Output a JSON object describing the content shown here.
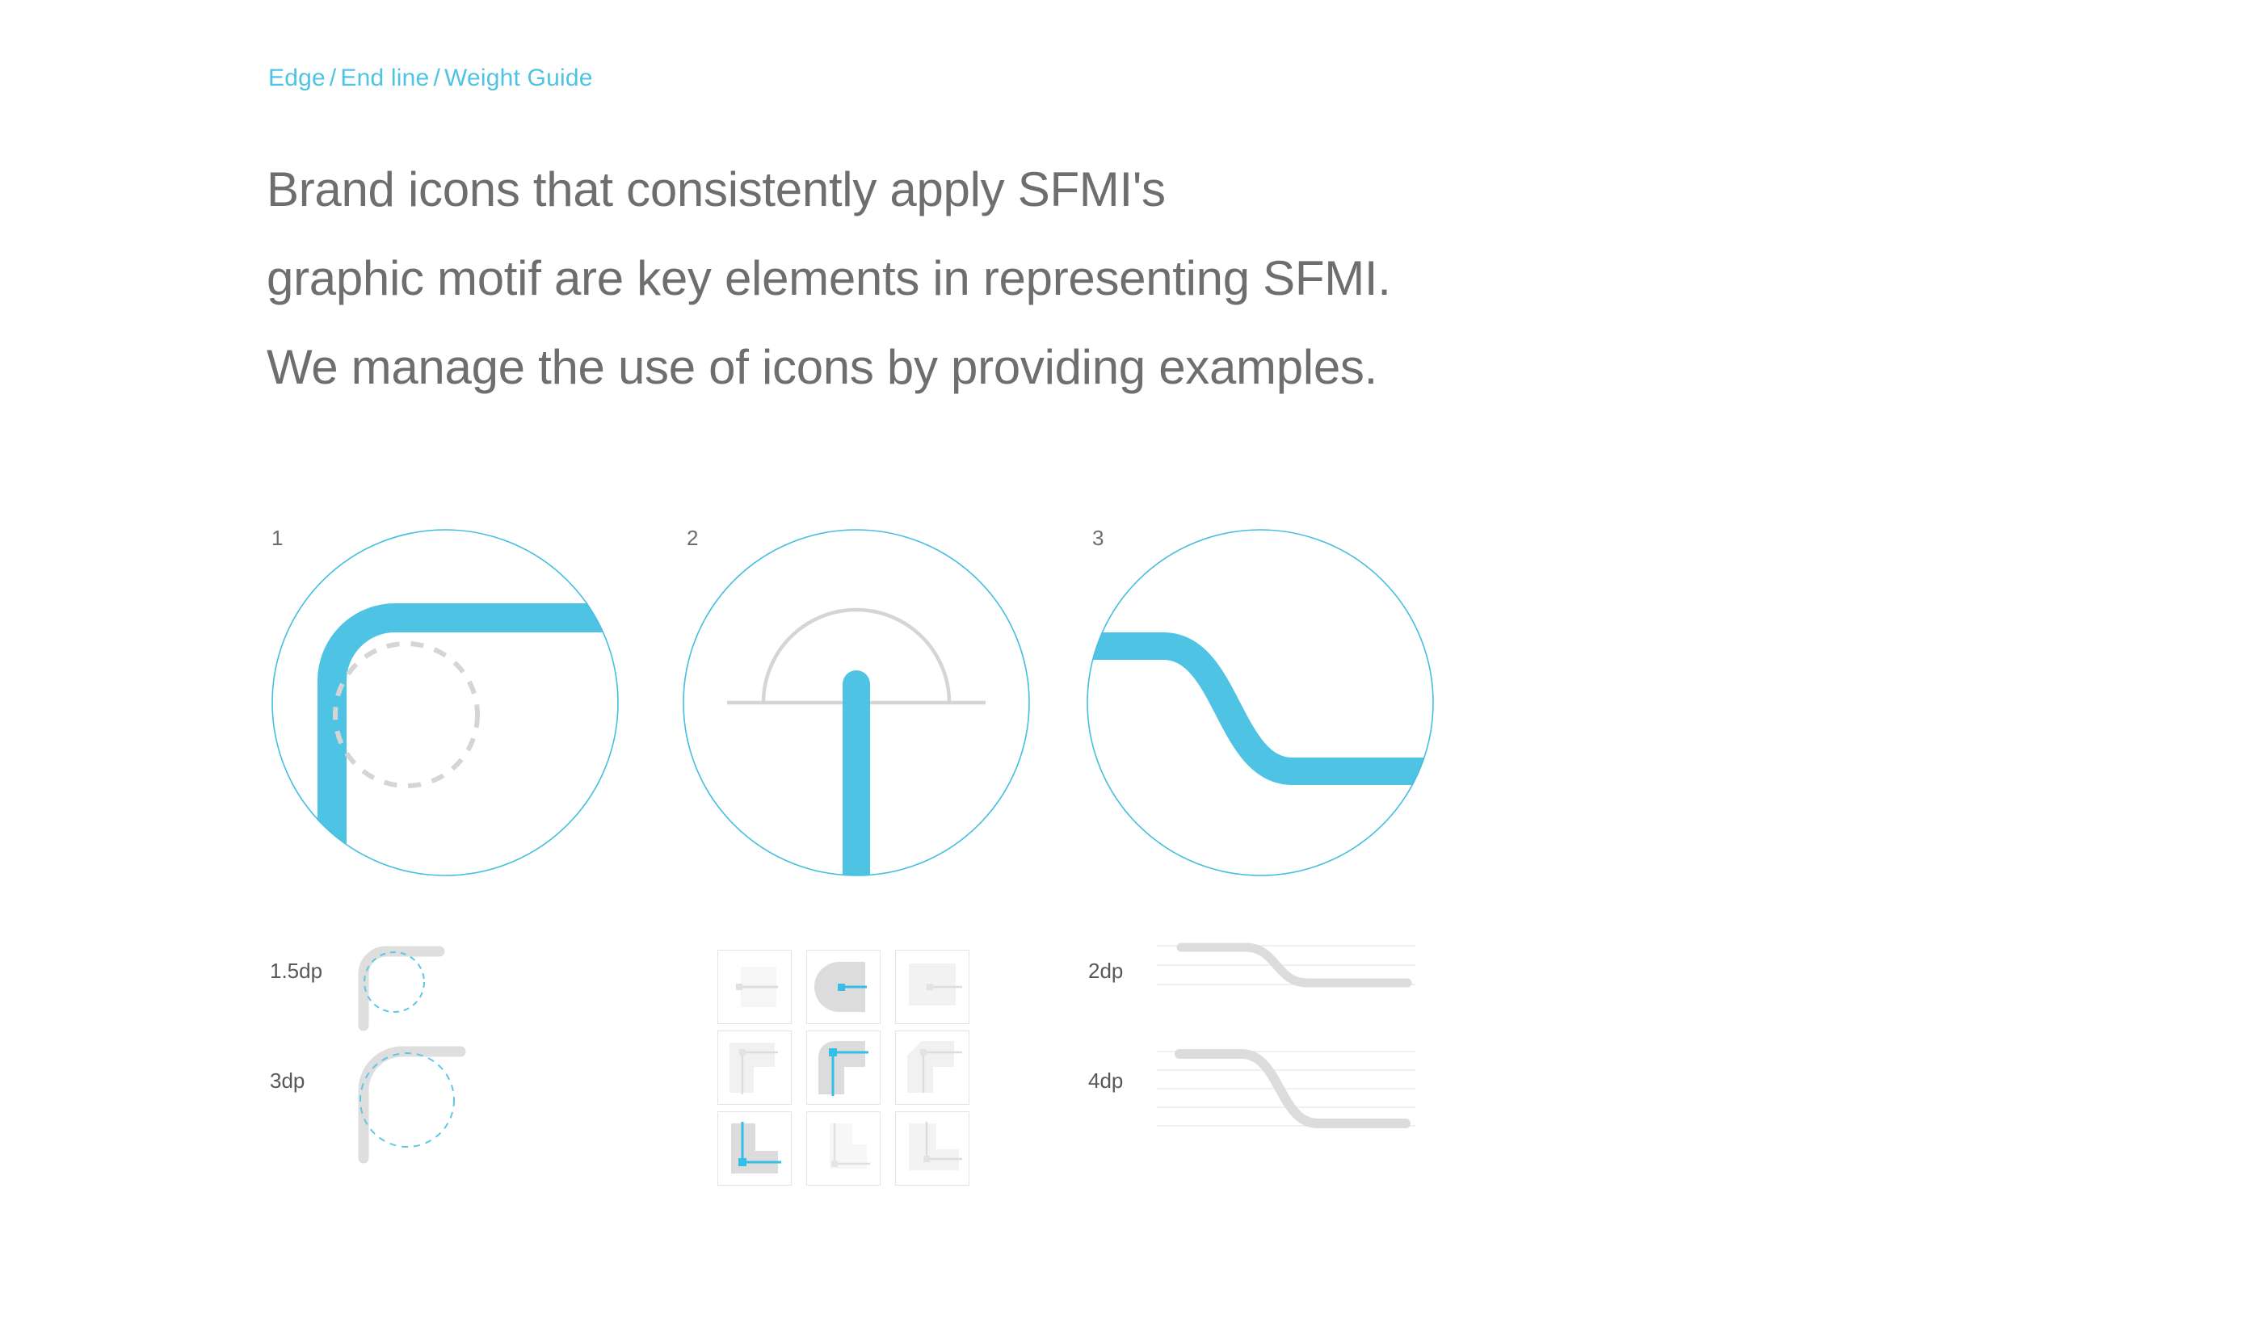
{
  "breadcrumb": {
    "items": [
      "Edge",
      "End line",
      "Weight Guide"
    ],
    "separator": "/",
    "color": "#4FC3E4",
    "item_0": "Edge",
    "item_1": "End line",
    "item_2": "Weight Guide"
  },
  "headline": {
    "line_1": "Brand icons that consistently apply SFMI's",
    "line_2": "graphic motif are key elements in representing SFMI.",
    "line_3": "We manage the use of icons by providing examples.",
    "color": "#6E6E6E"
  },
  "colors": {
    "accent_cyan": "#4FC3E4",
    "stroke_cyan": "#45BEE0",
    "text_grey": "#6E6E6E",
    "guide_grey": "#D8D8D8",
    "light_grey": "#EDEDED",
    "tile_border": "#E4E4E4",
    "background": "#FFFFFF"
  },
  "diagrams": [
    {
      "number": "1",
      "name": "rounded-corner-edge",
      "description": "Thick cyan rounded corner stroke with dashed grey construction circle inside a cyan outline circle"
    },
    {
      "number": "2",
      "name": "end-line-cap",
      "description": "Vertical cyan bar with rounded end cap, grey semicircular arc and horizontal baseline guide"
    },
    {
      "number": "3",
      "name": "s-curve-weight",
      "description": "Horizontal cyan S-curve band crossing the cyan outline circle"
    }
  ],
  "weight_samples": {
    "corner": [
      {
        "label": "1.5dp",
        "stroke_width": 1.5,
        "radius_small": true
      },
      {
        "label": "3dp",
        "stroke_width": 3,
        "radius_small": false
      }
    ],
    "curve": [
      {
        "label": "2dp",
        "stroke_width": 2,
        "guide_lines": 3
      },
      {
        "label": "4dp",
        "stroke_width": 4,
        "guide_lines": 5
      }
    ]
  },
  "tile_grid": {
    "rows": 3,
    "columns": 3,
    "tiles": [
      {
        "index": 1,
        "shape": "straight-edge",
        "highlighted": false,
        "name": "tile-straight-faint"
      },
      {
        "index": 2,
        "shape": "rounded-cap",
        "highlighted": true,
        "name": "tile-rounded-cap-active"
      },
      {
        "index": 3,
        "shape": "straight-edge",
        "highlighted": false,
        "name": "tile-straight-light"
      },
      {
        "index": 4,
        "shape": "corner-sharp",
        "highlighted": false,
        "name": "tile-corner-sharp"
      },
      {
        "index": 5,
        "shape": "corner-round",
        "highlighted": true,
        "name": "tile-corner-round-active"
      },
      {
        "index": 6,
        "shape": "corner-chamfer",
        "highlighted": false,
        "name": "tile-corner-chamfer"
      },
      {
        "index": 7,
        "shape": "corner-bottom-left",
        "highlighted": true,
        "name": "tile-corner-bottom-left-active"
      },
      {
        "index": 8,
        "shape": "corner-bottom-faint",
        "highlighted": false,
        "name": "tile-corner-bottom-faint"
      },
      {
        "index": 9,
        "shape": "corner-bottom-light",
        "highlighted": false,
        "name": "tile-corner-bottom-light"
      }
    ]
  }
}
